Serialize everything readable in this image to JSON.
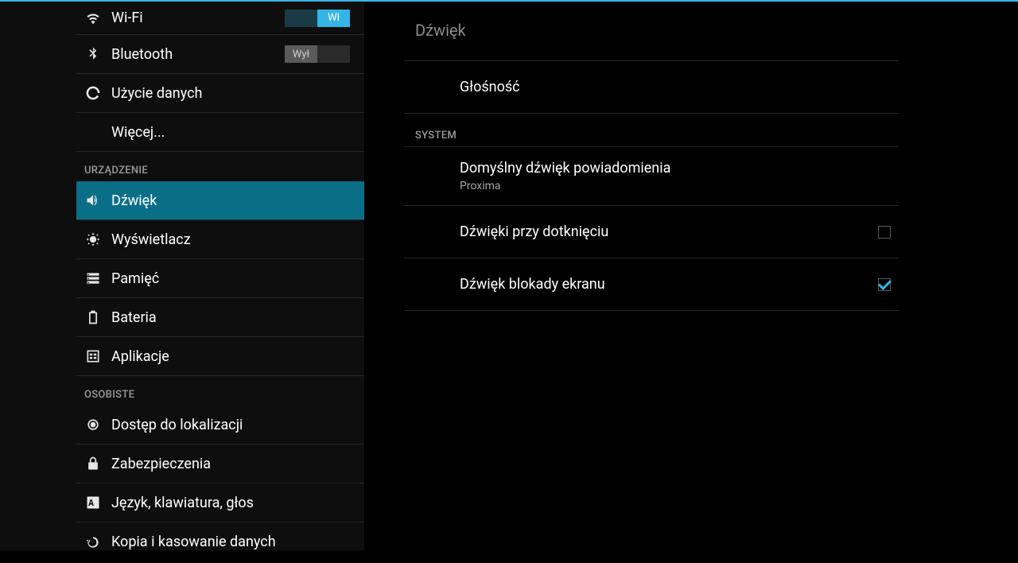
{
  "sidebar": {
    "wifi": {
      "label": "Wi-Fi",
      "toggle_on_label": "Wł"
    },
    "bluetooth": {
      "label": "Bluetooth",
      "toggle_off_label": "Wył"
    },
    "data_usage": {
      "label": "Użycie danych"
    },
    "more": {
      "label": "Więcej..."
    },
    "section_device": "URZĄDZENIE",
    "sound": {
      "label": "Dźwięk"
    },
    "display": {
      "label": "Wyświetlacz"
    },
    "storage": {
      "label": "Pamięć"
    },
    "battery": {
      "label": "Bateria"
    },
    "apps": {
      "label": "Aplikacje"
    },
    "section_personal": "OSOBISTE",
    "location": {
      "label": "Dostęp do lokalizacji"
    },
    "security": {
      "label": "Zabezpieczenia"
    },
    "language": {
      "label": "Język, klawiatura, głos"
    },
    "backup": {
      "label": "Kopia i kasowanie danych"
    }
  },
  "content": {
    "title": "Dźwięk",
    "volume": {
      "title": "Głośność"
    },
    "section_system": "SYSTEM",
    "default_notification": {
      "title": "Domyślny dźwięk powiadomienia",
      "sub": "Proxima"
    },
    "touch_sounds": {
      "title": "Dźwięki przy dotknięciu",
      "checked": false
    },
    "lock_sound": {
      "title": "Dźwięk blokady ekranu",
      "checked": true
    }
  }
}
